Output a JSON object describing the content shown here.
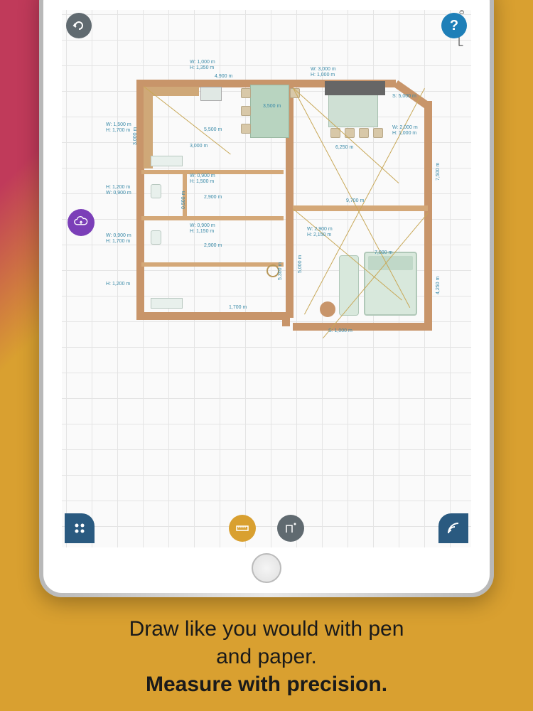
{
  "caption": {
    "line1": "Draw like you would with pen",
    "line2": "and paper.",
    "line3": "Measure with precision."
  },
  "scale_label": "1,000 m",
  "help_label": "?",
  "dims": {
    "d1": "W: 1,000 m",
    "d2": "H: 1,350 m",
    "d3": "4,900 m",
    "d4": "W: 3,000 m",
    "d5": "H: 1,000 m",
    "d6": "3,000 m",
    "d7": "W: 1,500 m",
    "d8": "H: 1,700 m",
    "d9": "5,500 m",
    "d10": "3,500 m",
    "d11": "6,250 m",
    "d12": "W: 2,000 m",
    "d13": "H: 1,000 m",
    "d14": "9,700 m",
    "d15": "W: 0,900 m",
    "d16": "H: 1,500 m",
    "d17": "H: 1,200 m",
    "d18": "W: 0,900 m",
    "d19": "2,900 m",
    "d20": "W: 0,900 m",
    "d21": "H: 1,150 m",
    "d22": "W: 0,900 m",
    "d23": "H: 1,700 m",
    "d24": "2,900 m",
    "d25": "5,000 m",
    "d26": "7,000 m",
    "d27": "S: 1,000 m",
    "d28": "W: 2,900 m",
    "d29": "H: 2,150 m",
    "d30": "4,250 m",
    "d31": "1,700 m",
    "d32": "5,300 m",
    "d33": "7,500 m",
    "d34": "S: 5,000 m",
    "d35": "H: 1,200 m",
    "d36": "3,000 m",
    "d37": "0,500 m"
  }
}
